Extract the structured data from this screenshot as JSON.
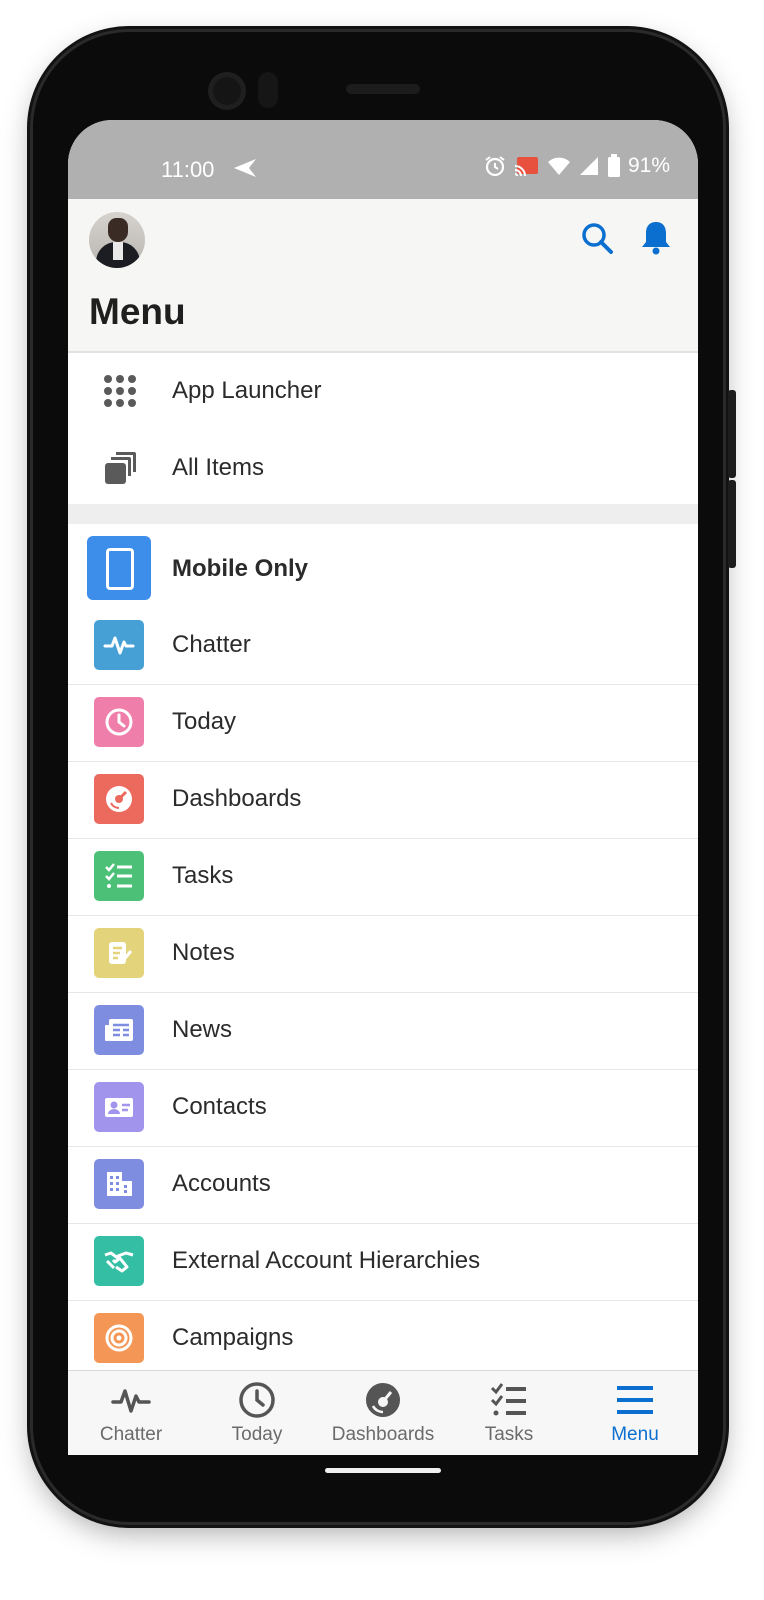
{
  "status_bar": {
    "time": "11:00",
    "battery": "91%"
  },
  "header": {
    "title": "Menu"
  },
  "top_items": [
    {
      "label": "App Launcher",
      "icon": "grid-icon"
    },
    {
      "label": "All Items",
      "icon": "stack-icon"
    }
  ],
  "mobile_group": {
    "label": "Mobile Only",
    "color": "#3d8eeb"
  },
  "menu_items": [
    {
      "label": "Chatter",
      "color": "#47a0d5",
      "icon": "pulse-icon"
    },
    {
      "label": "Today",
      "color": "#ef7eaa",
      "icon": "clock-icon"
    },
    {
      "label": "Dashboards",
      "color": "#ec6a5d",
      "icon": "gauge-icon"
    },
    {
      "label": "Tasks",
      "color": "#4bc076",
      "icon": "checklist-icon"
    },
    {
      "label": "Notes",
      "color": "#e3d37a",
      "icon": "note-icon"
    },
    {
      "label": "News",
      "color": "#7f8de1",
      "icon": "news-icon"
    },
    {
      "label": "Contacts",
      "color": "#a094ed",
      "icon": "contact-card-icon"
    },
    {
      "label": "Accounts",
      "color": "#7f8de1",
      "icon": "building-icon"
    },
    {
      "label": "External Account Hierarchies",
      "color": "#34bea4",
      "icon": "handshake-icon"
    },
    {
      "label": "Campaigns",
      "color": "#f49756",
      "icon": "target-icon"
    }
  ],
  "tabs": [
    {
      "label": "Chatter",
      "icon": "pulse-icon"
    },
    {
      "label": "Today",
      "icon": "clock-icon"
    },
    {
      "label": "Dashboards",
      "icon": "gauge-icon"
    },
    {
      "label": "Tasks",
      "icon": "checklist-icon"
    },
    {
      "label": "Menu",
      "icon": "hamburger-icon",
      "active": true
    }
  ],
  "accent_color": "#0b6fcf"
}
